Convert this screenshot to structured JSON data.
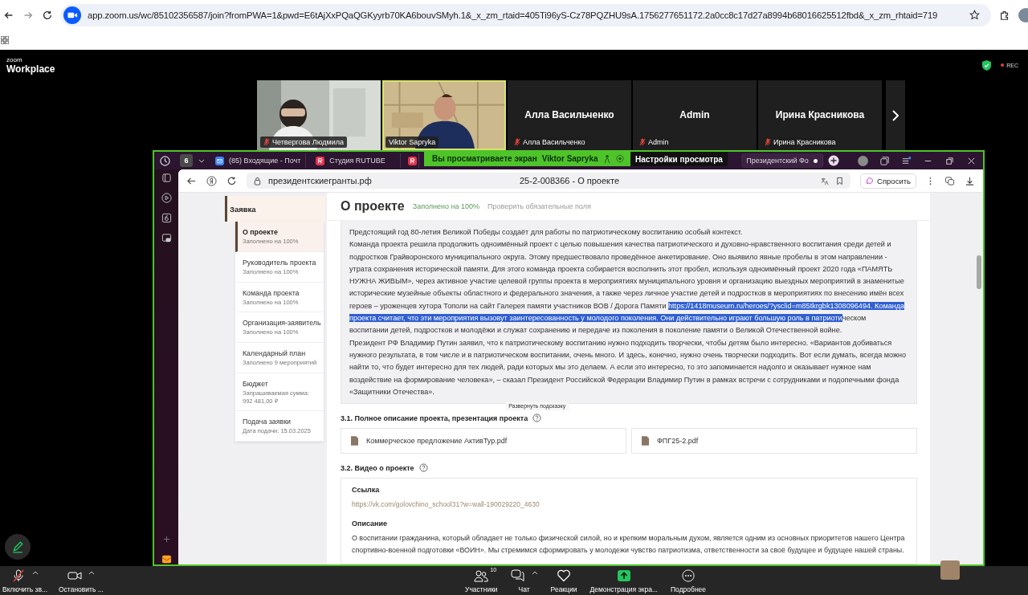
{
  "browser": {
    "url": "app.zoom.us/wc/85102356587/join?fromPWA=1&pwd=E6tAjXxPQaQGKyyrb70KA6bouvSMyh.1&_x_zm_rtaid=405Ti96yS-Cz78PQZHU9sA.1756277651172.2a0cc8c17d27a8994b68016625512fbd&_x_zm_rhtaid=719"
  },
  "zoom": {
    "brand_small": "zoom",
    "brand": "Workplace",
    "rec": "REC"
  },
  "participants": [
    {
      "kind": "video",
      "name": "Четвергова Людмила",
      "muted": true,
      "active": false
    },
    {
      "kind": "video",
      "name": "Viktor Sapryka",
      "muted": false,
      "active": true
    },
    {
      "kind": "name",
      "title": "Алла Васильченко",
      "name": "Алла Васильченко",
      "muted": true,
      "active": false
    },
    {
      "kind": "name",
      "title": "Admin",
      "name": "Admin",
      "muted": true,
      "active": false
    },
    {
      "kind": "name",
      "title": "Ирина Красникова",
      "name": "Ирина Красникова",
      "muted": true,
      "active": false
    }
  ],
  "share": {
    "banner": "Вы просматриваете экран",
    "presenter": "Viktor Sapryka",
    "settings": "Настройки просмотра"
  },
  "remote_browser": {
    "tab_count": "6",
    "tabs": [
      {
        "kind": "mail",
        "title": "(85) Входящие - Почт",
        "selected": false
      },
      {
        "kind": "rutube",
        "title": "Студия RUTUBE",
        "selected": false
      },
      {
        "kind": "rutube",
        "selected": false
      },
      {
        "kind": "site",
        "title": "Президентский Фо",
        "selected": true
      }
    ],
    "address": "президентскиегранты.рф",
    "page_title": "25-2-008366 - О проекте",
    "ask": "Спросить"
  },
  "page": {
    "nav_header": "Заявка",
    "nav": [
      {
        "title": "О проекте",
        "subtitle": "Заполнено на 100%",
        "selected": true
      },
      {
        "title": "Руководитель проекта",
        "subtitle": "Заполнено на 100%",
        "selected": false
      },
      {
        "title": "Команда проекта",
        "subtitle": "Заполнено на 100%",
        "selected": false
      },
      {
        "title": "Организация-заявитель",
        "subtitle": "Заполнено на 100%",
        "selected": false
      },
      {
        "title": "Календарный план",
        "subtitle": "Заполнено 9 мероприятий",
        "selected": false
      },
      {
        "title": "Бюджет",
        "subtitle": "Запрашиваемая сумма: 992 481,00 ₽",
        "selected": false
      },
      {
        "title": "Подача заявки",
        "subtitle": "Дата подачи: 15.03.2025",
        "selected": false
      }
    ],
    "heading": "О проекте",
    "fill_status": "Заполнено на 100%",
    "check_link": "Проверить обязательные поля",
    "description": [
      [
        {
          "text": "Предстоящий год 80-летия Великой Победы создаёт для работы по патриотическому воспитанию особый контекст.",
          "selected": false
        }
      ],
      [
        {
          "text": "Команда проекта решила продолжить одноимённый проект с целью повышения качества патриотического и духовно-нравственного воспитания среди детей и подростков Грайворонского муниципального округа. Этому предшествовало проведённое анкетирование. Оно выявило явные пробелы в этом направлении - утрата сохранения исторической памяти. Для этого команда проекта собирается восполнить этот пробел, используя одноимённый проект 2020 года «ПАМЯТЬ НУЖНА ЖИВЫМ», через активное участие целевой группы проекта в мероприятиях муниципального уровня и организацию выездных мероприятий в знаменитые исторические музейные объекты областного и федерального значения, а также через личное участие детей и подростков в мероприятиях по внесению имён всех героев – уроженцев хутора Тополи на сайт Галерея памяти участников ВОВ / Дорога Памяти ",
          "selected": false
        },
        {
          "text": "https://1418museum.ru/heroes/?ysclid=m85tkrgbk1308096494. Команда проекта считает, что эти мероприятия вызовут заинтересованность у молодого поколения. Они действительно играют большую роль в патриоти",
          "selected": true
        },
        {
          "text": "ческом воспитании детей, подростков и молодёжи и служат сохранению и передаче из поколения в поколение памяти о Великой Отечественной войне.",
          "selected": false
        }
      ],
      [
        {
          "text": "Президент РФ Владимир Путин заявил, что к патриотическому воспитанию нужно подходить творчески, чтобы детям было интересно. «Вариантов добиваться нужного результата, в том числе и в патриотическом воспитании, очень много. И здесь, конечно, нужно очень творчески подходить. Вот если думать, всегда можно найти то, что будет интересно для тех людей, ради которых мы это делаем. А если это интересно, то это запоминается надолго и оказывает нужное нам воздействие на формирование человека», – сказал Президент Российской Федерации Владимир Путин в рамках встречи с сотрудниками и подопечными фонда «Защитники Отечества».",
          "selected": false
        }
      ]
    ],
    "tooltip": "Развернуть подсказку",
    "section_files": {
      "title": "3.1. Полное описание проекта, презентация проекта",
      "files": [
        "Коммерческое предложение АктивТур.pdf",
        "ФПГ25-2.pdf"
      ]
    },
    "section_video": {
      "title": "3.2. Видео о проекте",
      "link_label": "Ссылка",
      "link": "https://vk.com/golovchino_school31?w=wall-190029220_4630",
      "desc_label": "Описание",
      "desc": "О воспитании гражданина, который обладает не только физической силой, но и крепким моральным духом, является одним из основных приоритетов нашего Центра спортивно-военной подготовки «ВОИН». Мы стремимся сформировать у молодежи чувство патриотизма, ответственности за своё будущее и будущее нашей страны."
    }
  },
  "toolbar": {
    "left": [
      {
        "kind": "mic",
        "label": "Включить зв..."
      },
      {
        "kind": "video",
        "label": "Остановить ..."
      }
    ],
    "center": [
      {
        "kind": "participants",
        "label": "Участники",
        "count": "10"
      },
      {
        "kind": "chat",
        "label": "Чат"
      },
      {
        "kind": "reactions",
        "label": "Реакции"
      },
      {
        "kind": "share",
        "label": "Демонстрация экра..."
      },
      {
        "kind": "more",
        "label": "Подробнее"
      }
    ]
  }
}
